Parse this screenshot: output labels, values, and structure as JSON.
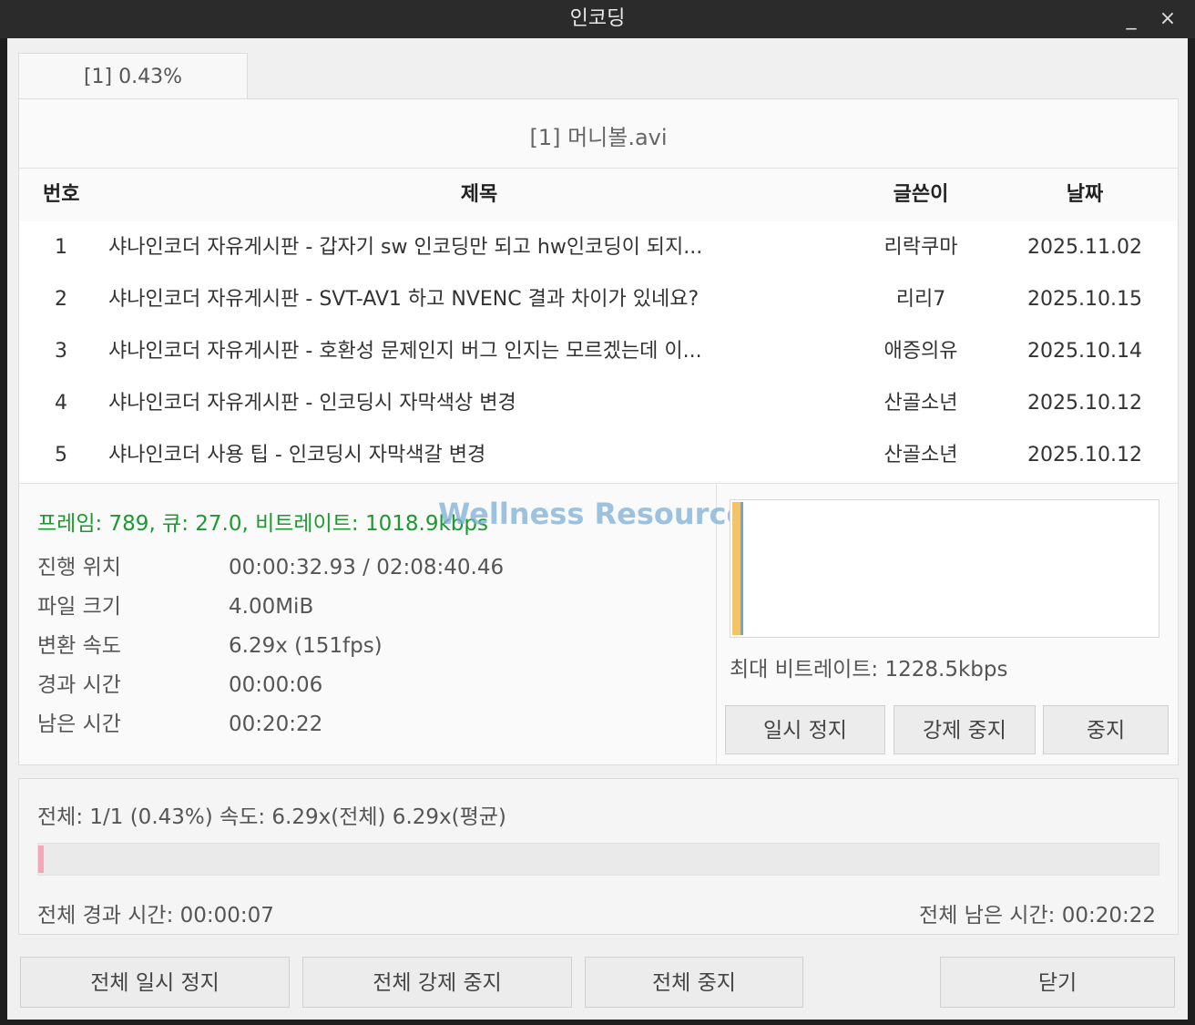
{
  "window": {
    "title": "인코딩",
    "minimize_glyph": "_",
    "close_glyph": "×"
  },
  "tab": {
    "label": "[1] 0.43%"
  },
  "file": {
    "name": "[1] 머니볼.avi"
  },
  "table": {
    "headers": {
      "no": "번호",
      "title": "제목",
      "author": "글쓴이",
      "date": "날짜"
    },
    "rows": [
      {
        "no": "1",
        "title": "샤나인코더 자유게시판 - 갑자기 sw 인코딩만 되고 hw인코딩이 되지...",
        "author": "리락쿠마",
        "date": "2025.11.02"
      },
      {
        "no": "2",
        "title": "샤나인코더 자유게시판 - SVT-AV1 하고 NVENC 결과 차이가 있네요?",
        "author": "리리7",
        "date": "2025.10.15"
      },
      {
        "no": "3",
        "title": "샤나인코더 자유게시판 - 호환성 문제인지 버그 인지는 모르겠는데 이...",
        "author": "애증의유",
        "date": "2025.10.14"
      },
      {
        "no": "4",
        "title": "샤나인코더 자유게시판 - 인코딩시 자막색상 변경",
        "author": "산골소년",
        "date": "2025.10.12"
      },
      {
        "no": "5",
        "title": "샤나인코더 사용 팁 - 인코딩시 자막색갈 변경",
        "author": "산골소년",
        "date": "2025.10.12"
      }
    ]
  },
  "stats": {
    "frame_line": "프레임: 789, 큐: 27.0, 비트레이트: 1018.9kbps",
    "watermark": "Wellness Resources",
    "rows": [
      {
        "label": "진행 위치",
        "value": "00:00:32.93 / 02:08:40.46"
      },
      {
        "label": "파일 크기",
        "value": "4.00MiB"
      },
      {
        "label": "변환 속도",
        "value": "6.29x (151fps)"
      },
      {
        "label": "경과 시간",
        "value": "00:00:06"
      },
      {
        "label": "남은 시간",
        "value": "00:20:22"
      }
    ]
  },
  "graph": {
    "max_bitrate": "최대 비트레이트: 1228.5kbps",
    "colors": {
      "bar": "#f3c46a",
      "line": "#6aa6d8"
    }
  },
  "job_buttons": {
    "pause": "일시 정지",
    "force_stop": "강제 중지",
    "stop": "중지"
  },
  "total": {
    "summary": "전체: 1/1 (0.43%) 속도: 6.29x(전체) 6.29x(평균)",
    "progress": 0.0043,
    "elapsed": "전체 경과 시간: 00:00:07",
    "remaining": "전체 남은 시간: 00:20:22",
    "progress_color": "#f4a7b5"
  },
  "footer_buttons": {
    "pause_all": "전체 일시 정지",
    "force_stop_all": "전체 강제 중지",
    "stop_all": "전체 중지",
    "close": "닫기"
  }
}
